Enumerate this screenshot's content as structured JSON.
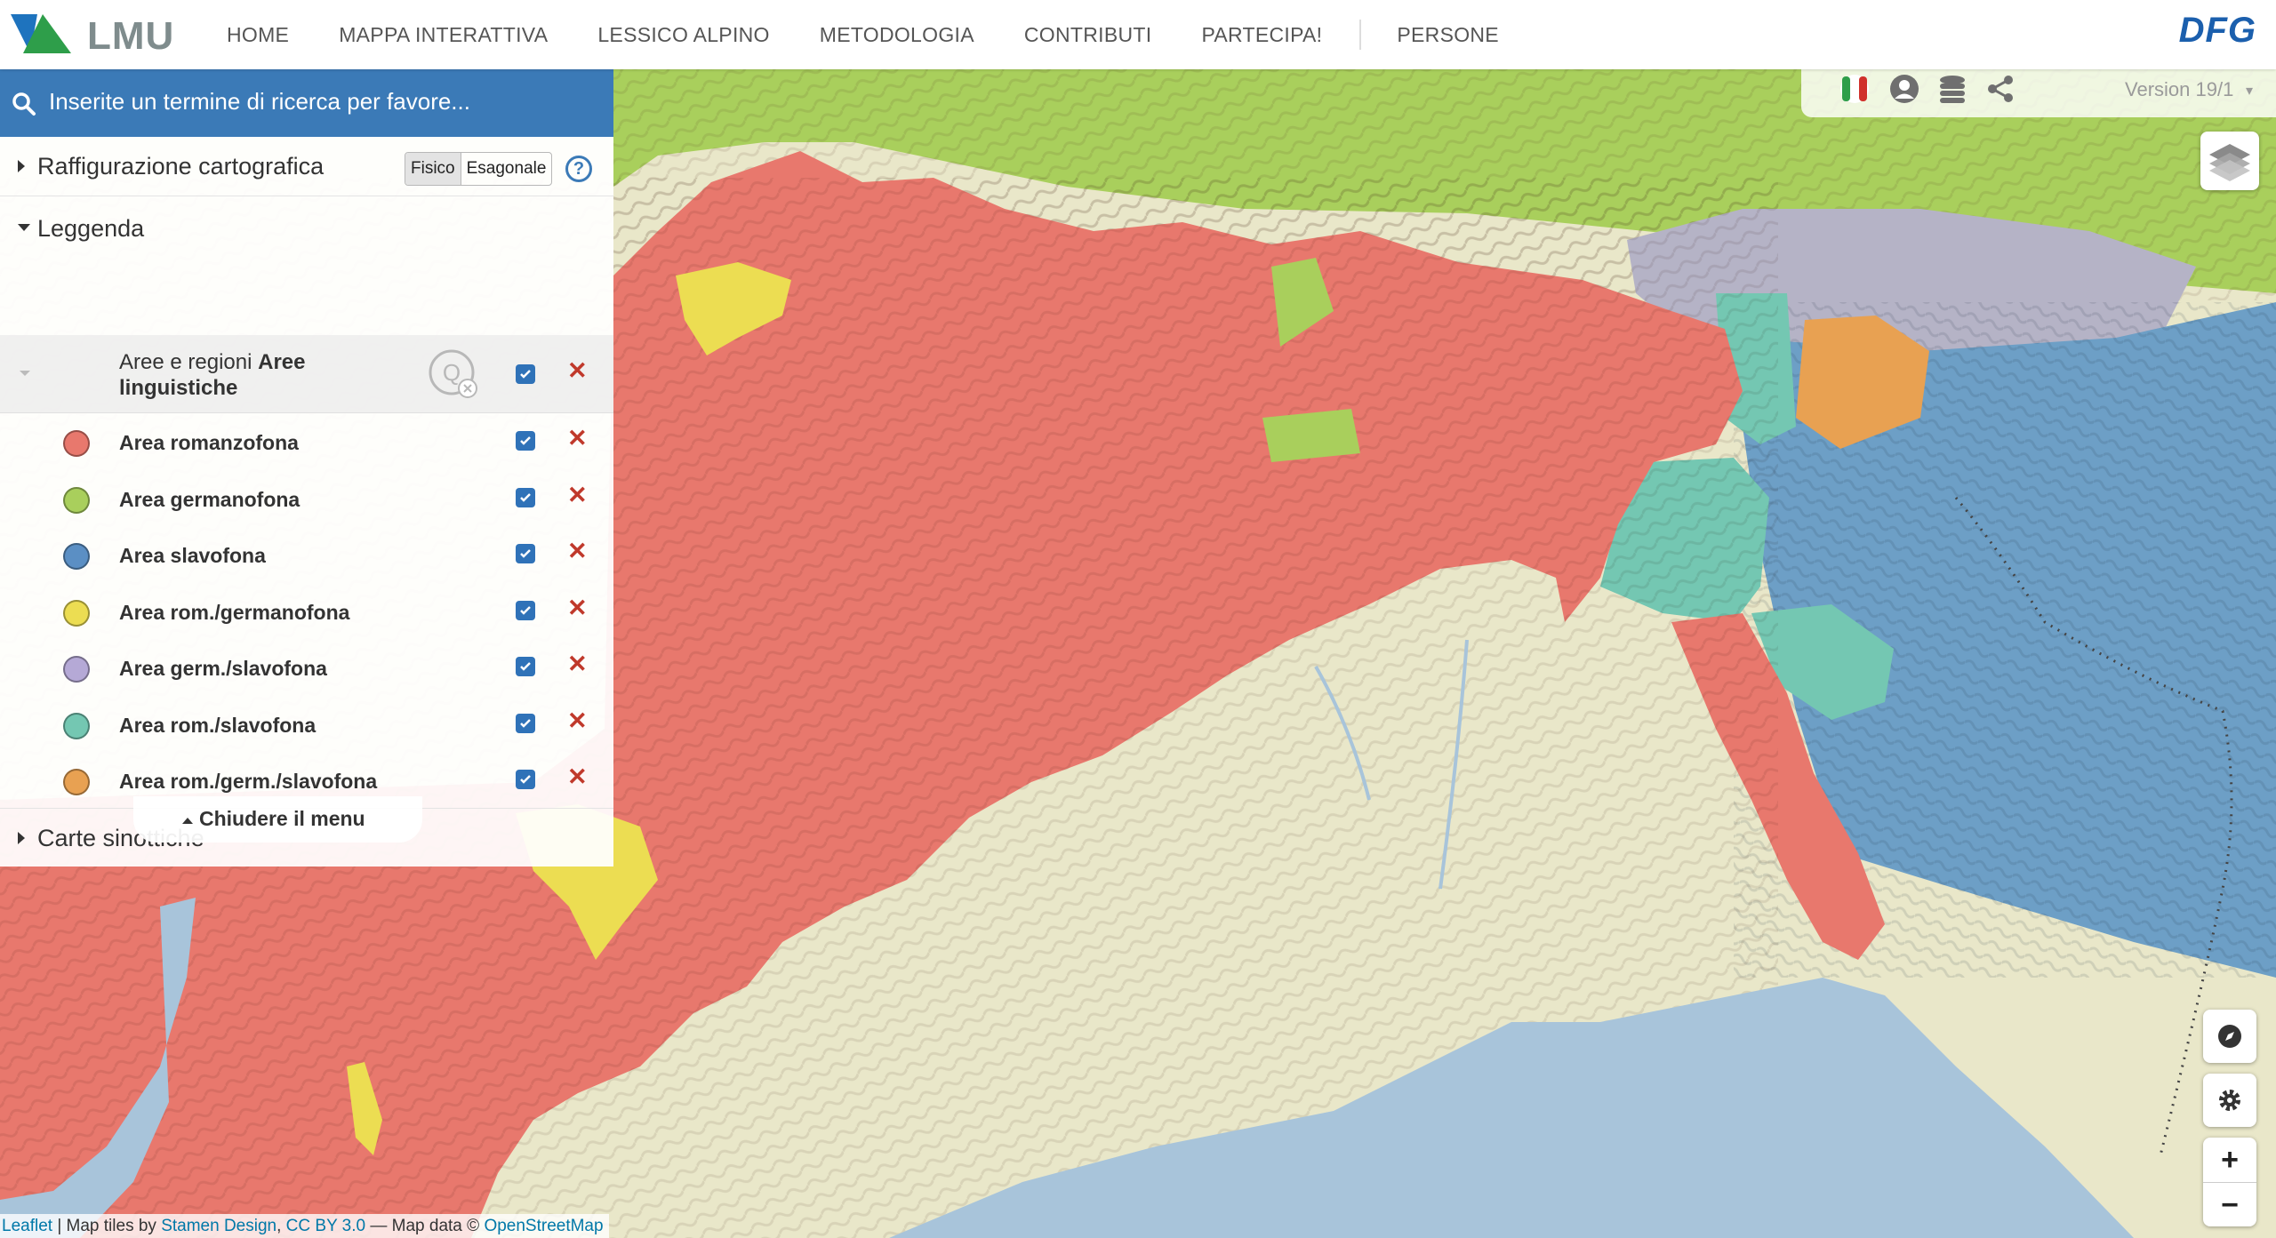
{
  "header": {
    "logo_text": "LMU",
    "nav": [
      "HOME",
      "MAPPA INTERATTIVA",
      "LESSICO ALPINO",
      "METODOLOGIA",
      "CONTRIBUTI",
      "PARTECIPA!",
      "PERSONE"
    ],
    "funder": "DFG"
  },
  "search": {
    "placeholder": "Inserite un termine di ricerca per favore..."
  },
  "panel": {
    "cartography": {
      "title": "Raffigurazione cartografica",
      "options": [
        "Fisico",
        "Esagonale"
      ],
      "selected": "Fisico",
      "help": "?"
    },
    "legend": {
      "title": "Leggenda",
      "group_prefix": "Aree e regioni",
      "group_name": "Aree linguistiche",
      "items": [
        {
          "label": "Area romanzofona",
          "color": "#e8786d"
        },
        {
          "label": "Area germanofona",
          "color": "#a9cf5c"
        },
        {
          "label": "Area slavofona",
          "color": "#5b8fc4"
        },
        {
          "label": "Area rom./germanofona",
          "color": "#ecdd52"
        },
        {
          "label": "Area germ./slavofona",
          "color": "#b5a9d6"
        },
        {
          "label": "Area rom./slavofona",
          "color": "#74c7b2"
        },
        {
          "label": "Area rom./germ./slavofona",
          "color": "#e8a152"
        }
      ]
    },
    "synoptic": {
      "title": "Carte sinottiche"
    },
    "close_menu": "Chiudere il menu"
  },
  "toolbar": {
    "version": "Version 19/1"
  },
  "map": {
    "zoom_in": "+",
    "zoom_out": "−",
    "attribution": {
      "leaflet": "Leaflet",
      "sep1": " | Map tiles by ",
      "stamen": "Stamen Design",
      "comma": ", ",
      "license": "CC BY 3.0",
      "dash": " — Map data © ",
      "osm": "OpenStreetMap"
    }
  },
  "colors": {
    "accent": "#3b7ab7",
    "romance": "#e8786d",
    "germanic": "#a9cf5c",
    "slavic": "#6d9fc6",
    "lowland": "#e9e7c9",
    "sea": "#a8c4da"
  }
}
